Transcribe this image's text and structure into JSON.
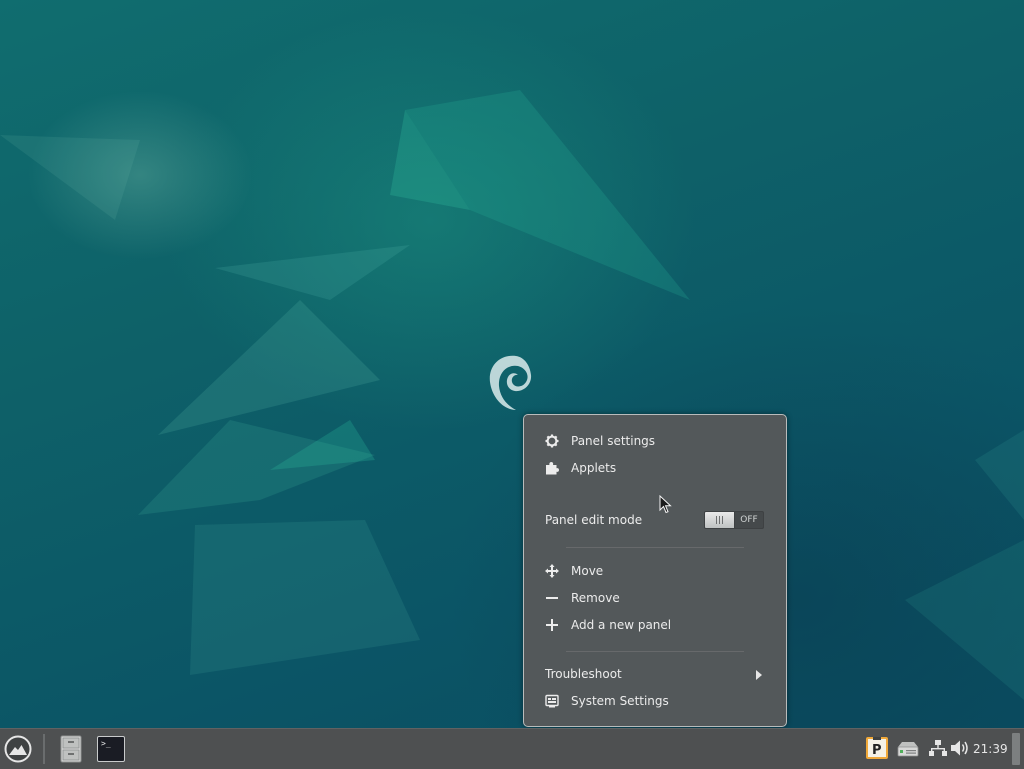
{
  "colors": {
    "desktop_bg": "#0d5a63",
    "menu_bg": "#53585a",
    "menu_border": "#b9bcbc",
    "menu_text": "#ececec",
    "taskbar_bg": "#4e5051",
    "tray_p_accent": "#f0a93a"
  },
  "desktop": {
    "logo": "debian-swirl"
  },
  "context_menu": {
    "items": [
      {
        "label": "Panel settings",
        "icon": "gear-icon"
      },
      {
        "label": "Applets",
        "icon": "puzzle-icon"
      }
    ],
    "edit_mode": {
      "label": "Panel edit mode",
      "toggle_state": "OFF",
      "enabled": false
    },
    "panel_actions": [
      {
        "label": "Move",
        "icon": "move-icon"
      },
      {
        "label": "Remove",
        "icon": "minus-icon"
      },
      {
        "label": "Add a new panel",
        "icon": "plus-icon"
      }
    ],
    "troubleshoot": {
      "label": "Troubleshoot",
      "icon": "chevron-right-icon"
    },
    "system_settings": {
      "label": "System Settings",
      "icon": "system-settings-icon"
    }
  },
  "taskbar": {
    "menu_button_icon": "mountain-menu-icon",
    "launchers": [
      {
        "name": "file-manager",
        "icon": "filing-cabinet-icon"
      },
      {
        "name": "terminal",
        "icon": "terminal-icon",
        "glyph": ">_"
      }
    ],
    "tray": [
      {
        "name": "tray-p",
        "icon": "p-indicator-icon",
        "glyph": "P"
      },
      {
        "name": "tray-drive",
        "icon": "removable-drive-icon"
      },
      {
        "name": "tray-network",
        "icon": "network-icon"
      },
      {
        "name": "tray-volume",
        "icon": "speaker-volume-icon"
      }
    ],
    "clock": "21:39"
  }
}
